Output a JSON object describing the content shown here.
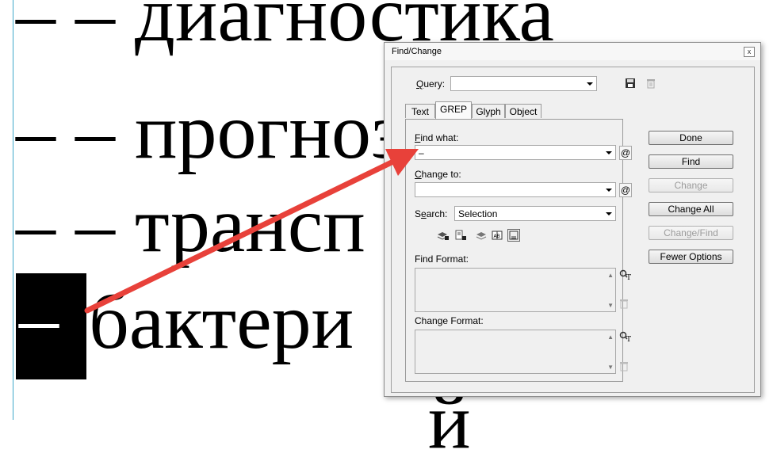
{
  "document": {
    "lines": [
      {
        "prefix": "– –",
        "text": "диагностика"
      },
      {
        "prefix": "– –",
        "text": "прогноз"
      },
      {
        "prefix": "– –",
        "text": "трансп"
      },
      {
        "prefix": "–",
        "text": "бактери"
      },
      {
        "prefix": "",
        "text": "й"
      }
    ]
  },
  "dialog": {
    "title": "Find/Change",
    "close_label": "x",
    "query_label": "Query:",
    "query_value": "",
    "tabs": [
      {
        "label": "Text",
        "active": false
      },
      {
        "label": "GREP",
        "active": true
      },
      {
        "label": "Glyph",
        "active": false
      },
      {
        "label": "Object",
        "active": false
      }
    ],
    "find_what_label": "Find what:",
    "find_what_value": "–",
    "change_to_label": "Change to:",
    "change_to_value": "",
    "at_symbol": "@",
    "search_label": "Search:",
    "search_value": "Selection",
    "find_format_label": "Find Format:",
    "change_format_label": "Change Format:",
    "buttons": [
      {
        "label": "Done",
        "enabled": true
      },
      {
        "label": "Find",
        "enabled": true
      },
      {
        "label": "Change",
        "enabled": false
      },
      {
        "label": "Change All",
        "enabled": true
      },
      {
        "label": "Change/Find",
        "enabled": false
      },
      {
        "label": "Fewer Options",
        "enabled": true
      }
    ]
  },
  "annotation": {
    "arrow_color": "#e8413a"
  },
  "icons": [
    "save-query-icon",
    "delete-query-icon",
    "special-chars-icon",
    "include-locked-layers-icon",
    "include-locked-stories-icon",
    "include-hidden-layers-icon",
    "include-master-pages-icon",
    "include-footnotes-icon",
    "specify-attributes-icon",
    "clear-attributes-icon"
  ]
}
